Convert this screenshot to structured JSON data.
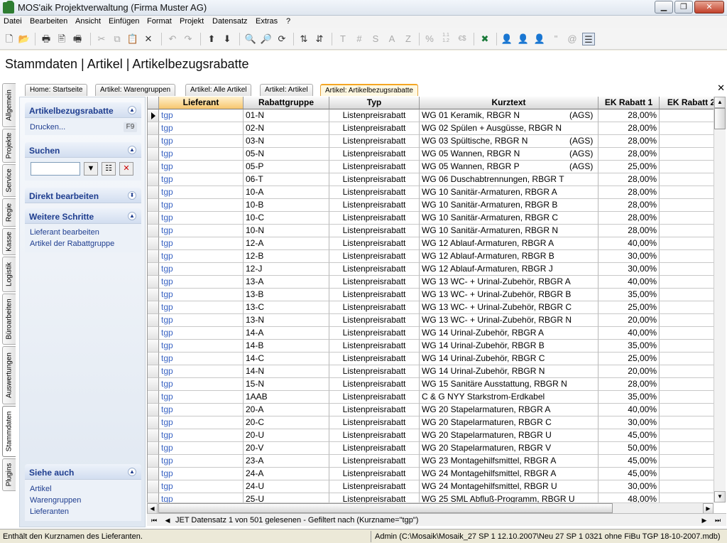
{
  "window": {
    "title": "MOS'aik Projektverwaltung (Firma Muster AG)"
  },
  "menu": [
    "Datei",
    "Bearbeiten",
    "Ansicht",
    "Einfügen",
    "Format",
    "Projekt",
    "Datensatz",
    "Extras",
    "?"
  ],
  "toolbar": {
    "text_buttons": [
      "T",
      "#",
      "S",
      "A",
      "Z",
      "%",
      "1.1 1.2",
      "€$",
      "\""
    ]
  },
  "breadcrumb": "Stammdaten | Artikel | Artikelbezugsrabatte",
  "left_tabs": [
    "Allgemein",
    "Projekte",
    "Service",
    "Regie",
    "Kasse",
    "Logistik",
    "Büroarbeiten",
    "Auswertungen",
    "Stammdaten",
    "Plugins"
  ],
  "doc_tabs": [
    "Home: Startseite",
    "Artikel: Warengruppen",
    "Artikel: Alle Artikel",
    "Artikel: Artikel",
    "Artikel: Artikelbezugsrabatte"
  ],
  "sidebar": {
    "box1": {
      "title": "Artikelbezugsrabatte",
      "item": "Drucken...",
      "shortcut": "F9"
    },
    "box2": {
      "title": "Suchen",
      "search_value": ""
    },
    "box3": {
      "title": "Direkt bearbeiten"
    },
    "box4": {
      "title": "Weitere Schritte",
      "items": [
        "Lieferant bearbeiten",
        "Artikel der Rabattgruppe"
      ]
    },
    "box5": {
      "title": "Siehe auch",
      "items": [
        "Artikel",
        "Warengruppen",
        "Lieferanten"
      ]
    }
  },
  "grid": {
    "columns": [
      "Lieferant",
      "Rabattgruppe",
      "Typ",
      "Kurztext",
      "EK Rabatt 1",
      "EK Rabatt 2"
    ],
    "rows": [
      [
        "tgp",
        "01-N",
        "Listenpreisrabatt",
        "WG 01 Keramik, RBGR N",
        "(AGS)",
        "28,00%"
      ],
      [
        "tgp",
        "02-N",
        "Listenpreisrabatt",
        "WG 02 Spülen + Ausgüsse, RBGR N",
        "",
        "28,00%"
      ],
      [
        "tgp",
        "03-N",
        "Listenpreisrabatt",
        "WG 03 Spültische, RBGR N",
        "(AGS)",
        "28,00%"
      ],
      [
        "tgp",
        "05-N",
        "Listenpreisrabatt",
        "WG 05 Wannen, RBGR N",
        "(AGS)",
        "28,00%"
      ],
      [
        "tgp",
        "05-P",
        "Listenpreisrabatt",
        "WG 05 Wannen, RBGR P",
        "(AGS)",
        "25,00%"
      ],
      [
        "tgp",
        "06-T",
        "Listenpreisrabatt",
        "WG 06 Duschabtrennungen, RBGR T",
        "",
        "28,00%"
      ],
      [
        "tgp",
        "10-A",
        "Listenpreisrabatt",
        "WG 10 Sanitär-Armaturen, RBGR A",
        "",
        "28,00%"
      ],
      [
        "tgp",
        "10-B",
        "Listenpreisrabatt",
        "WG 10 Sanitär-Armaturen, RBGR B",
        "",
        "28,00%"
      ],
      [
        "tgp",
        "10-C",
        "Listenpreisrabatt",
        "WG 10 Sanitär-Armaturen, RBGR C",
        "",
        "28,00%"
      ],
      [
        "tgp",
        "10-N",
        "Listenpreisrabatt",
        "WG 10 Sanitär-Armaturen, RBGR N",
        "",
        "28,00%"
      ],
      [
        "tgp",
        "12-A",
        "Listenpreisrabatt",
        "WG 12 Ablauf-Armaturen, RBGR A",
        "",
        "40,00%"
      ],
      [
        "tgp",
        "12-B",
        "Listenpreisrabatt",
        "WG 12 Ablauf-Armaturen, RBGR B",
        "",
        "30,00%"
      ],
      [
        "tgp",
        "12-J",
        "Listenpreisrabatt",
        "WG 12 Ablauf-Armaturen, RBGR J",
        "",
        "30,00%"
      ],
      [
        "tgp",
        "13-A",
        "Listenpreisrabatt",
        "WG 13 WC- + Urinal-Zubehör, RBGR A",
        "",
        "40,00%"
      ],
      [
        "tgp",
        "13-B",
        "Listenpreisrabatt",
        "WG 13 WC- + Urinal-Zubehör, RBGR B",
        "",
        "35,00%"
      ],
      [
        "tgp",
        "13-C",
        "Listenpreisrabatt",
        "WG 13 WC- + Urinal-Zubehör, RBGR C",
        "",
        "25,00%"
      ],
      [
        "tgp",
        "13-N",
        "Listenpreisrabatt",
        "WG 13 WC- + Urinal-Zubehör, RBGR N",
        "",
        "20,00%"
      ],
      [
        "tgp",
        "14-A",
        "Listenpreisrabatt",
        "WG 14 Urinal-Zubehör, RBGR A",
        "",
        "40,00%"
      ],
      [
        "tgp",
        "14-B",
        "Listenpreisrabatt",
        "WG 14 Urinal-Zubehör, RBGR B",
        "",
        "35,00%"
      ],
      [
        "tgp",
        "14-C",
        "Listenpreisrabatt",
        "WG 14 Urinal-Zubehör, RBGR C",
        "",
        "25,00%"
      ],
      [
        "tgp",
        "14-N",
        "Listenpreisrabatt",
        "WG 14 Urinal-Zubehör, RBGR N",
        "",
        "20,00%"
      ],
      [
        "tgp",
        "15-N",
        "Listenpreisrabatt",
        "WG 15 Sanitäre Ausstattung, RBGR N",
        "",
        "28,00%"
      ],
      [
        "tgp",
        "1AAB",
        "Listenpreisrabatt",
        "C & G  NYY Starkstrom-Erdkabel",
        "",
        "35,00%"
      ],
      [
        "tgp",
        "20-A",
        "Listenpreisrabatt",
        "WG 20 Stapelarmaturen, RBGR A",
        "",
        "40,00%"
      ],
      [
        "tgp",
        "20-C",
        "Listenpreisrabatt",
        "WG 20 Stapelarmaturen, RBGR C",
        "",
        "30,00%"
      ],
      [
        "tgp",
        "20-U",
        "Listenpreisrabatt",
        "WG 20 Stapelarmaturen, RBGR U",
        "",
        "45,00%"
      ],
      [
        "tgp",
        "20-V",
        "Listenpreisrabatt",
        "WG 20 Stapelarmaturen, RBGR V",
        "",
        "50,00%"
      ],
      [
        "tgp",
        "23-A",
        "Listenpreisrabatt",
        "WG 23 Montagehilfsmittel, RBGR A",
        "",
        "45,00%"
      ],
      [
        "tgp",
        "24-A",
        "Listenpreisrabatt",
        "WG 24 Montagehilfsmittel, RBGR A",
        "",
        "45,00%"
      ],
      [
        "tgp",
        "24-U",
        "Listenpreisrabatt",
        "WG 24 Montagehilfsmittel, RBGR U",
        "",
        "30,00%"
      ],
      [
        "tgp",
        "25-U",
        "Listenpreisrabatt",
        "WG 25 SML Abfluß-Programm, RBGR U",
        "",
        "48,00%"
      ]
    ]
  },
  "navbar": {
    "text": "JET Datensatz 1 von 501 gelesenen - Gefiltert nach (Kurzname=\"tgp\")"
  },
  "statusbar": {
    "left": "Enthält den Kurznamen des Lieferanten.",
    "right": "Admin (C:\\Mosaik\\Mosaik_27 SP 1 12.10.2007\\Neu 27 SP 1 0321 ohne FiBu TGP 18-10-2007.mdb)"
  }
}
